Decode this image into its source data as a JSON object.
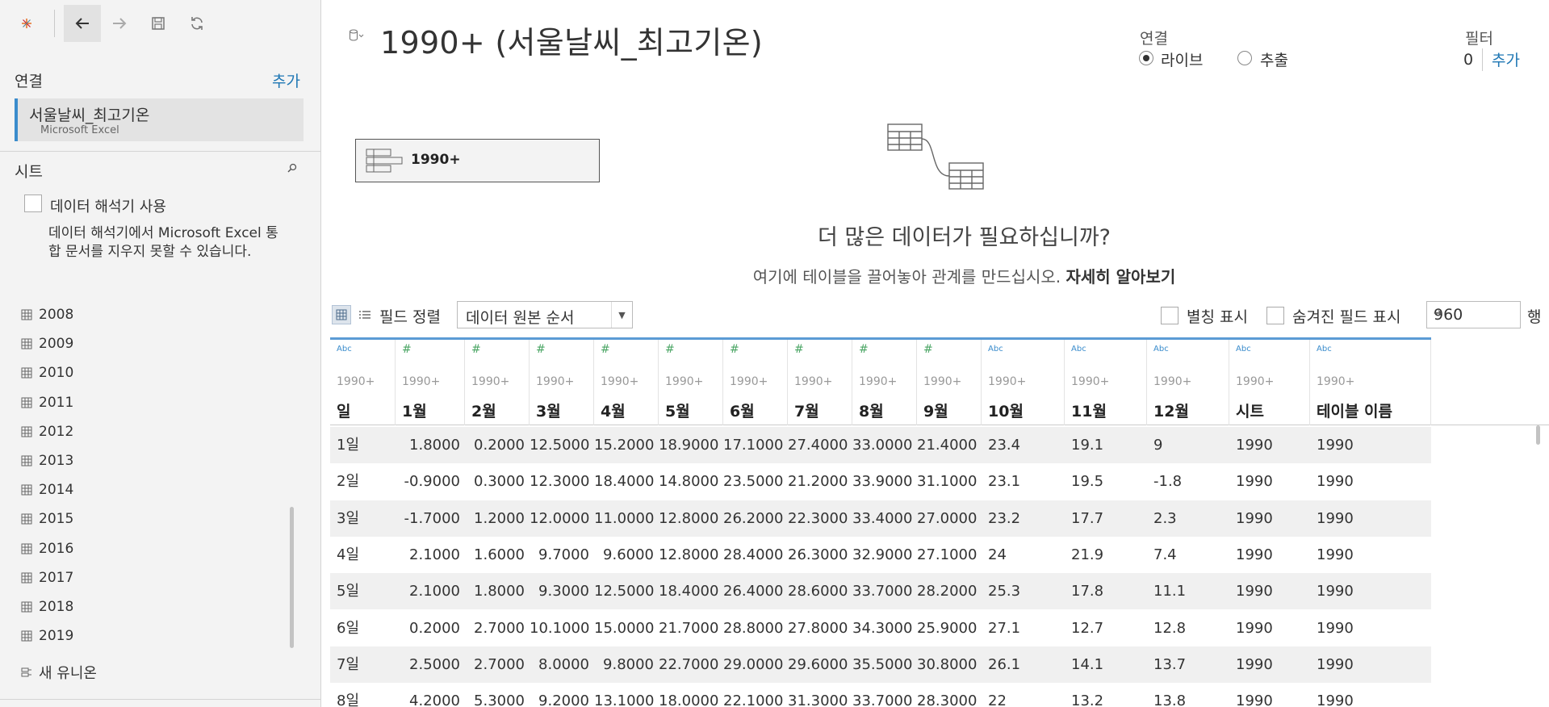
{
  "toolbar": {
    "logo": "tableau-logo",
    "back": "back-arrow",
    "forward": "forward-arrow",
    "save": "save",
    "refresh": "refresh"
  },
  "sidebar": {
    "connections_title": "연결",
    "connections_add": "추가",
    "connection": {
      "name": "서울날씨_최고기온",
      "type": "Microsoft Excel"
    },
    "sheets_title": "시트",
    "interpreter_label": "데이터 해석기 사용",
    "interpreter_desc": "데이터 해석기에서 Microsoft Excel 통합 문서를 지우지 못할 수 있습니다.",
    "sheets": [
      "2008",
      "2009",
      "2010",
      "2011",
      "2012",
      "2013",
      "2014",
      "2015",
      "2016",
      "2017",
      "2018",
      "2019"
    ],
    "new_union": "새 유니온"
  },
  "header": {
    "datasource_title": "1990+ (서울날씨_최고기온)",
    "connection_label": "연결",
    "live_label": "라이브",
    "extract_label": "추출",
    "live_selected": true,
    "filter_label": "필터",
    "filter_count": "0",
    "filter_add": "추가"
  },
  "canvas": {
    "table_name": "1990+",
    "more_data": "더 많은 데이터가 필요하십니까?",
    "drag_hint": "여기에 테이블을 끌어놓아 관계를 만드십시오.",
    "learn_more": "자세히 알아보기"
  },
  "grid_toolbar": {
    "sort_label": "필드 정렬",
    "sort_value": "데이터 원본 순서",
    "show_aliases": "별칭 표시",
    "show_hidden": "숨겨진 필드 표시",
    "rows_value": "960",
    "rows_label": "행"
  },
  "colors": {
    "accent": "#1f77b4",
    "selected_border": "#3a8ccc",
    "number_type": "#4aa564"
  },
  "grid": {
    "columns": [
      {
        "type": "Abc",
        "source": "1990+",
        "name": "일"
      },
      {
        "type": "#",
        "source": "1990+",
        "name": "1월"
      },
      {
        "type": "#",
        "source": "1990+",
        "name": "2월"
      },
      {
        "type": "#",
        "source": "1990+",
        "name": "3월"
      },
      {
        "type": "#",
        "source": "1990+",
        "name": "4월"
      },
      {
        "type": "#",
        "source": "1990+",
        "name": "5월"
      },
      {
        "type": "#",
        "source": "1990+",
        "name": "6월"
      },
      {
        "type": "#",
        "source": "1990+",
        "name": "7월"
      },
      {
        "type": "#",
        "source": "1990+",
        "name": "8월"
      },
      {
        "type": "#",
        "source": "1990+",
        "name": "9월"
      },
      {
        "type": "Abc",
        "source": "1990+",
        "name": "10월"
      },
      {
        "type": "Abc",
        "source": "1990+",
        "name": "11월"
      },
      {
        "type": "Abc",
        "source": "1990+",
        "name": "12월"
      },
      {
        "type": "Abc",
        "source": "1990+",
        "name": "시트"
      },
      {
        "type": "Abc",
        "source": "1990+",
        "name": "테이블 이름"
      }
    ],
    "rows": [
      [
        "1일",
        "1.8000",
        "0.2000",
        "12.5000",
        "15.2000",
        "18.9000",
        "17.1000",
        "27.4000",
        "33.0000",
        "21.4000",
        "23.4",
        "19.1",
        "9",
        "1990",
        "1990"
      ],
      [
        "2일",
        "-0.9000",
        "0.3000",
        "12.3000",
        "18.4000",
        "14.8000",
        "23.5000",
        "21.2000",
        "33.9000",
        "31.1000",
        "23.1",
        "19.5",
        "-1.8",
        "1990",
        "1990"
      ],
      [
        "3일",
        "-1.7000",
        "1.2000",
        "12.0000",
        "11.0000",
        "12.8000",
        "26.2000",
        "22.3000",
        "33.4000",
        "27.0000",
        "23.2",
        "17.7",
        "2.3",
        "1990",
        "1990"
      ],
      [
        "4일",
        "2.1000",
        "1.6000",
        "9.7000",
        "9.6000",
        "12.8000",
        "28.4000",
        "26.3000",
        "32.9000",
        "27.1000",
        "24",
        "21.9",
        "7.4",
        "1990",
        "1990"
      ],
      [
        "5일",
        "2.1000",
        "1.8000",
        "9.3000",
        "12.5000",
        "18.4000",
        "26.4000",
        "28.6000",
        "33.7000",
        "28.2000",
        "25.3",
        "17.8",
        "11.1",
        "1990",
        "1990"
      ],
      [
        "6일",
        "0.2000",
        "2.7000",
        "10.1000",
        "15.0000",
        "21.7000",
        "28.8000",
        "27.8000",
        "34.3000",
        "25.9000",
        "27.1",
        "12.7",
        "12.8",
        "1990",
        "1990"
      ],
      [
        "7일",
        "2.5000",
        "2.7000",
        "8.0000",
        "9.8000",
        "22.7000",
        "29.0000",
        "29.6000",
        "35.5000",
        "30.8000",
        "26.1",
        "14.1",
        "13.7",
        "1990",
        "1990"
      ],
      [
        "8일",
        "4.2000",
        "5.3000",
        "9.2000",
        "13.1000",
        "18.0000",
        "22.1000",
        "31.3000",
        "33.7000",
        "28.3000",
        "22",
        "13.2",
        "13.8",
        "1990",
        "1990"
      ]
    ]
  }
}
